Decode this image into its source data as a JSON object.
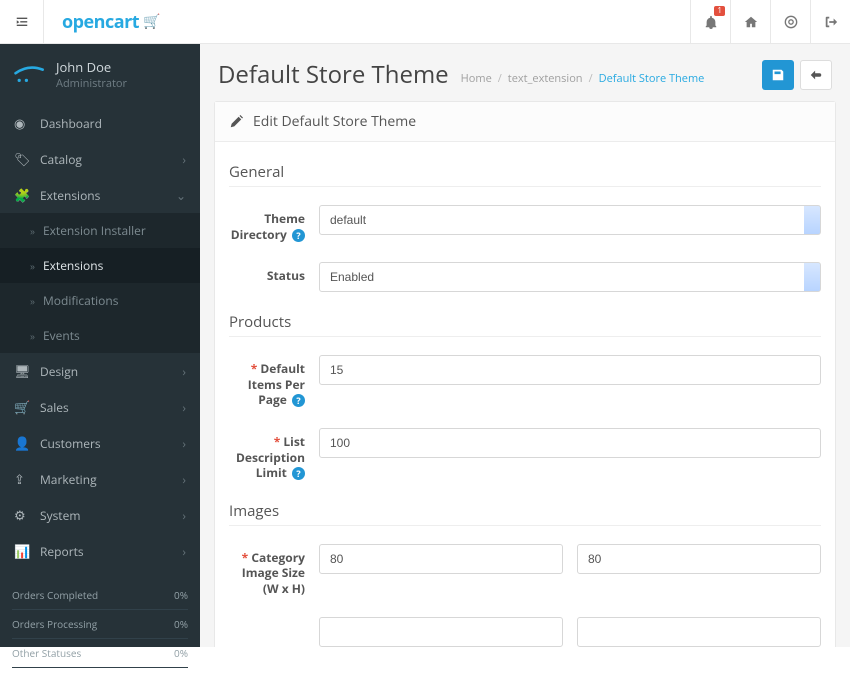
{
  "logo": "opencart",
  "topbar": {
    "badge": "1"
  },
  "profile": {
    "name": "John Doe",
    "role": "Administrator"
  },
  "nav": {
    "dashboard": "Dashboard",
    "catalog": "Catalog",
    "extensions": "Extensions",
    "ext_installer": "Extension Installer",
    "ext_extensions": "Extensions",
    "ext_mods": "Modifications",
    "ext_events": "Events",
    "design": "Design",
    "sales": "Sales",
    "customers": "Customers",
    "marketing": "Marketing",
    "system": "System",
    "reports": "Reports"
  },
  "stats": {
    "completed": {
      "label": "Orders Completed",
      "value": "0%"
    },
    "processing": {
      "label": "Orders Processing",
      "value": "0%"
    },
    "other": {
      "label": "Other Statuses",
      "value": "0%"
    }
  },
  "page": {
    "title": "Default Store Theme",
    "crumb_home": "Home",
    "crumb_ext": "text_extension",
    "crumb_current": "Default Store Theme"
  },
  "panel": {
    "title": "Edit Default Store Theme"
  },
  "sections": {
    "general": "General",
    "products": "Products",
    "images": "Images"
  },
  "fields": {
    "theme_dir": {
      "label": "Theme Directory",
      "value": "default"
    },
    "status": {
      "label": "Status",
      "value": "Enabled"
    },
    "items_per_page": {
      "label": "Default Items Per Page",
      "value": "15"
    },
    "list_desc": {
      "label": "List Description Limit",
      "value": "100"
    },
    "cat_img": {
      "label": "Category Image Size (W x H)",
      "w": "80",
      "h": "80"
    }
  }
}
